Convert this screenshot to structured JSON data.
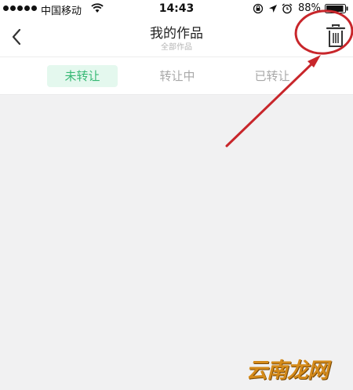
{
  "status_bar": {
    "carrier": "中国移动",
    "time": "14:43",
    "battery": "88%",
    "icons": [
      "signal-dots",
      "wifi-icon",
      "orientation-lock-icon",
      "location-icon",
      "alarm-icon",
      "battery-icon"
    ]
  },
  "header": {
    "title": "我的作品",
    "subtitle": "全部作品",
    "back_icon": "chevron-left-icon",
    "action_icon": "trash-icon"
  },
  "tabs": [
    {
      "label": "未转让",
      "active": true
    },
    {
      "label": "转让中",
      "active": false
    },
    {
      "label": "已转让",
      "active": false
    }
  ],
  "colors": {
    "accent": "#36b874",
    "tab_active_bg": "#e4f8ee",
    "annotation": "#c8262b",
    "background": "#f1f1f2"
  },
  "watermark": {
    "text": "云南龙网"
  }
}
